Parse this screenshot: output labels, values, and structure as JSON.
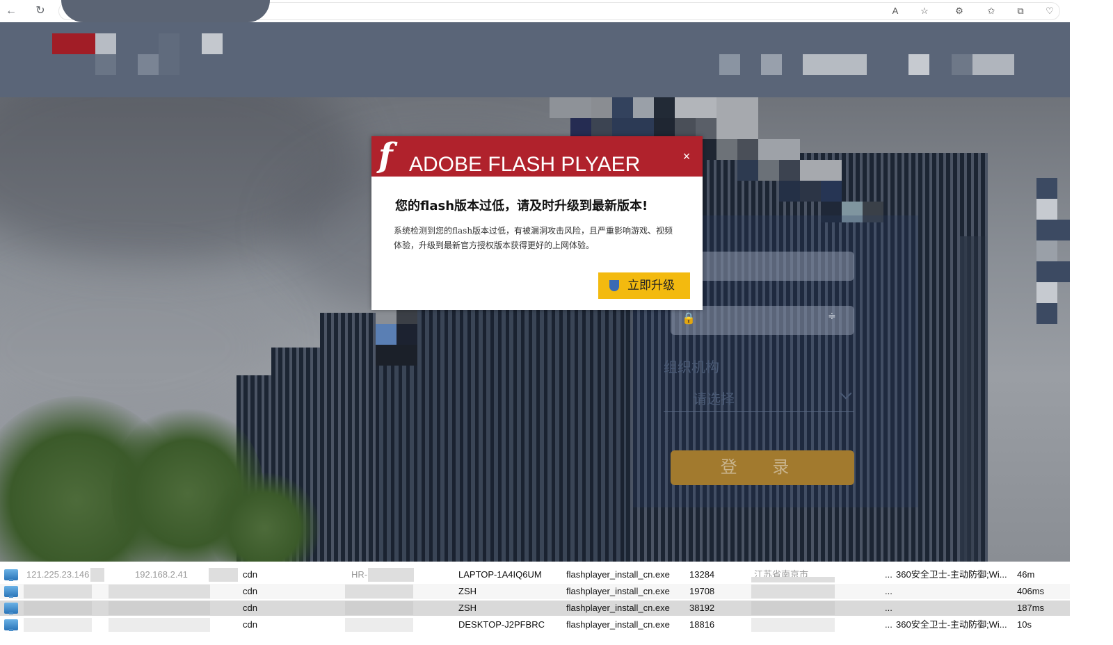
{
  "browser": {
    "back_icon": "←",
    "refresh_icon": "↻",
    "read_aloud_icon": "A",
    "favorite_icon": "☆",
    "extensions_icon": "⚙",
    "favorites_icon": "✩",
    "collections_icon": "⧉",
    "health_icon": "♡"
  },
  "login": {
    "org_label": "组织机构",
    "org_select": "请选择",
    "login_button": "登 录"
  },
  "popup": {
    "title": "ADOBE FLASH PLYAER",
    "close": "×",
    "heading": "您的flash版本过低，请及时升级到最新版本!",
    "body": "系统检测到您的flash版本过低，有被漏洞攻击风险，且严重影响游戏、视频体验，升级到最新官方授权版本获得更好的上网体验。",
    "upgrade_button": "立即升级"
  },
  "table": {
    "rows": [
      {
        "ip1": "121.225.23.146",
        "ip2": "192.168.2.41",
        "type": "cdn",
        "tag": "HR-1",
        "host": "LAPTOP-1A4IQ6UM",
        "file": "flashplayer_install_cn.exe",
        "pid": "13284",
        "region": "江苏省南京市",
        "ellipsis": "...",
        "av": "360安全卫士-主动防御;Wi...",
        "time": "46m"
      },
      {
        "ip1": "",
        "ip2": "",
        "type": "cdn",
        "tag": "",
        "host": "ZSH",
        "file": "flashplayer_install_cn.exe",
        "pid": "19708",
        "region": "",
        "ellipsis": "...",
        "av": "",
        "time": "406ms"
      },
      {
        "ip1": "",
        "ip2": "",
        "type": "cdn",
        "tag": "",
        "host": "ZSH",
        "file": "flashplayer_install_cn.exe",
        "pid": "38192",
        "region": "",
        "ellipsis": "...",
        "av": "",
        "time": "187ms"
      },
      {
        "ip1": "",
        "ip2": "",
        "type": "cdn",
        "tag": "",
        "host": "DESKTOP-J2PFBRC",
        "file": "flashplayer_install_cn.exe",
        "pid": "18816",
        "region": "",
        "ellipsis": "...",
        "av": "360安全卫士-主动防御;Wi...",
        "time": "10s"
      }
    ]
  },
  "colors": {
    "header_bg": "#5a6578",
    "popup_red": "#b0222c",
    "upgrade_yellow": "#f3ba0f",
    "login_orange": "#a27a2e"
  }
}
